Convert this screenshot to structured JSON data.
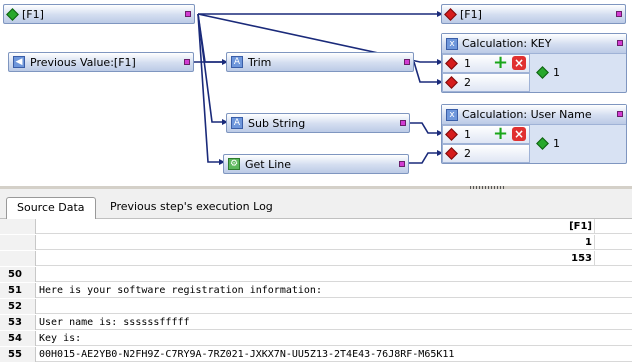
{
  "canvas": {
    "nodes": {
      "f1_source": {
        "label": "[F1]",
        "icon": "green-diamond-icon"
      },
      "previous_value": {
        "label": "Previous Value:[F1]",
        "icon": "previous-value-icon"
      },
      "trim": {
        "label": "Trim",
        "icon": "function-icon"
      },
      "sub_string": {
        "label": "Sub String",
        "icon": "function-icon"
      },
      "get_line": {
        "label": "Get Line",
        "icon": "getline-icon"
      },
      "f1_output": {
        "label": "[F1]",
        "icon": "red-diamond-icon"
      }
    },
    "calc_key": {
      "title": "Calculation: KEY",
      "in1": "1",
      "in2": "2",
      "out": "1"
    },
    "calc_user": {
      "title": "Calculation: User Name",
      "in1": "1",
      "in2": "2",
      "out": "1"
    }
  },
  "tabs": [
    {
      "label": "Source Data",
      "active": true
    },
    {
      "label": "Previous step's execution Log",
      "active": false
    }
  ],
  "grid": {
    "header_rows": [
      "[F1]",
      "1",
      "153"
    ],
    "rows": [
      {
        "num": "50",
        "text": ""
      },
      {
        "num": "51",
        "text": "Here is your software registration information:"
      },
      {
        "num": "52",
        "text": ""
      },
      {
        "num": "53",
        "text": "User name is: ssssssfffff"
      },
      {
        "num": "54",
        "text": "Key is:"
      },
      {
        "num": "55",
        "text": "00H015-AE2YB0-N2FH9Z-C7RY9A-7RZ021-JXKX7N-UU5Z13-2T4E43-76J8RF-M65K11"
      }
    ]
  },
  "colors": {
    "port": "#d23cd2",
    "node_border": "#7f96c0",
    "wire": "#1a2a7a",
    "accent_red": "#d51c1c",
    "accent_green": "#28a82c"
  }
}
